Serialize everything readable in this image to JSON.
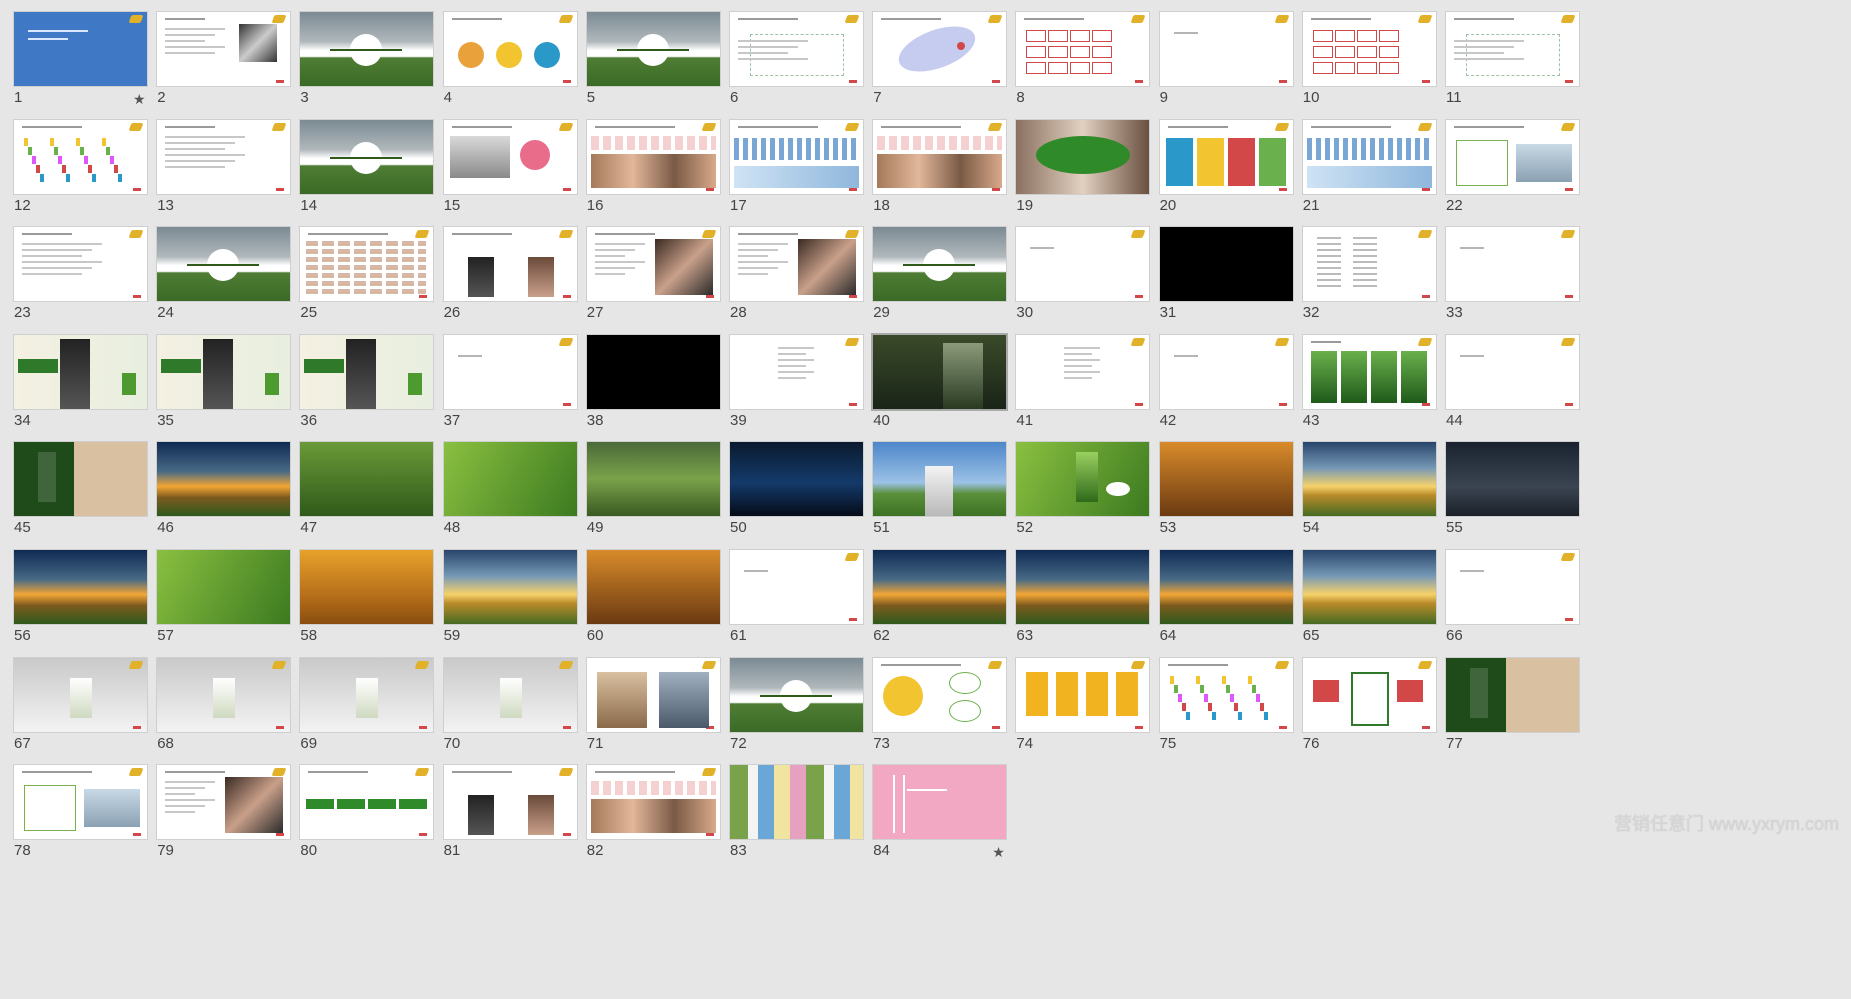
{
  "app": {
    "view": "slide-sorter"
  },
  "slides": [
    {
      "number": "1",
      "thumb": "blue",
      "selected": false,
      "star": true
    },
    {
      "number": "2",
      "thumb": "text-photo"
    },
    {
      "number": "3",
      "thumb": "field"
    },
    {
      "number": "4",
      "thumb": "circles"
    },
    {
      "number": "5",
      "thumb": "field"
    },
    {
      "number": "6",
      "thumb": "diagram"
    },
    {
      "number": "7",
      "thumb": "ellipse"
    },
    {
      "number": "8",
      "thumb": "table-red"
    },
    {
      "number": "9",
      "thumb": "blank-text"
    },
    {
      "number": "10",
      "thumb": "table-red"
    },
    {
      "number": "11",
      "thumb": "diagram"
    },
    {
      "number": "12",
      "thumb": "bars"
    },
    {
      "number": "13",
      "thumb": "text"
    },
    {
      "number": "14",
      "thumb": "field"
    },
    {
      "number": "15",
      "thumb": "photo-chart"
    },
    {
      "number": "16",
      "thumb": "photo-strip"
    },
    {
      "number": "17",
      "thumb": "chart-strip"
    },
    {
      "number": "18",
      "thumb": "photo-strip"
    },
    {
      "number": "19",
      "thumb": "photo-green"
    },
    {
      "number": "20",
      "thumb": "colorful"
    },
    {
      "number": "21",
      "thumb": "chart-strip"
    },
    {
      "number": "22",
      "thumb": "diagram-photo"
    },
    {
      "number": "23",
      "thumb": "text"
    },
    {
      "number": "24",
      "thumb": "field"
    },
    {
      "number": "25",
      "thumb": "table-list"
    },
    {
      "number": "26",
      "thumb": "people"
    },
    {
      "number": "27",
      "thumb": "photo-right"
    },
    {
      "number": "28",
      "thumb": "photo-right"
    },
    {
      "number": "29",
      "thumb": "field"
    },
    {
      "number": "30",
      "thumb": "blank-text"
    },
    {
      "number": "31",
      "thumb": "black"
    },
    {
      "number": "32",
      "thumb": "text-columns"
    },
    {
      "number": "33",
      "thumb": "blank-text"
    },
    {
      "number": "34",
      "thumb": "ad"
    },
    {
      "number": "35",
      "thumb": "ad"
    },
    {
      "number": "36",
      "thumb": "ad"
    },
    {
      "number": "37",
      "thumb": "blank-text"
    },
    {
      "number": "38",
      "thumb": "black"
    },
    {
      "number": "39",
      "thumb": "center-text"
    },
    {
      "number": "40",
      "thumb": "dark-photo",
      "selected": true
    },
    {
      "number": "41",
      "thumb": "center-text"
    },
    {
      "number": "42",
      "thumb": "blank-text"
    },
    {
      "number": "43",
      "thumb": "packs"
    },
    {
      "number": "44",
      "thumb": "blank-text"
    },
    {
      "number": "45",
      "thumb": "green-ad"
    },
    {
      "number": "46",
      "thumb": "sunset"
    },
    {
      "number": "47",
      "thumb": "green"
    },
    {
      "number": "48",
      "thumb": "green2"
    },
    {
      "number": "49",
      "thumb": "field2"
    },
    {
      "number": "50",
      "thumb": "night"
    },
    {
      "number": "51",
      "thumb": "sky"
    },
    {
      "number": "52",
      "thumb": "product-green"
    },
    {
      "number": "53",
      "thumb": "warm"
    },
    {
      "number": "54",
      "thumb": "sunset2"
    },
    {
      "number": "55",
      "thumb": "night2"
    },
    {
      "number": "56",
      "thumb": "sunset"
    },
    {
      "number": "57",
      "thumb": "green2"
    },
    {
      "number": "58",
      "thumb": "wheat"
    },
    {
      "number": "59",
      "thumb": "sunset2"
    },
    {
      "number": "60",
      "thumb": "warm"
    },
    {
      "number": "61",
      "thumb": "blank-text"
    },
    {
      "number": "62",
      "thumb": "sunset"
    },
    {
      "number": "63",
      "thumb": "sunset"
    },
    {
      "number": "64",
      "thumb": "sunset"
    },
    {
      "number": "65",
      "thumb": "sunset2"
    },
    {
      "number": "66",
      "thumb": "blank-text"
    },
    {
      "number": "67",
      "thumb": "room"
    },
    {
      "number": "68",
      "thumb": "room"
    },
    {
      "number": "69",
      "thumb": "room"
    },
    {
      "number": "70",
      "thumb": "room"
    },
    {
      "number": "71",
      "thumb": "phones"
    },
    {
      "number": "72",
      "thumb": "field"
    },
    {
      "number": "73",
      "thumb": "yellow-diagram"
    },
    {
      "number": "74",
      "thumb": "yellow-bars"
    },
    {
      "number": "75",
      "thumb": "bars"
    },
    {
      "number": "76",
      "thumb": "red-flow"
    },
    {
      "number": "77",
      "thumb": "green-ad"
    },
    {
      "number": "78",
      "thumb": "diagram-photo"
    },
    {
      "number": "79",
      "thumb": "photo-right"
    },
    {
      "number": "80",
      "thumb": "green-flow"
    },
    {
      "number": "81",
      "thumb": "people"
    },
    {
      "number": "82",
      "thumb": "photo-strip"
    },
    {
      "number": "83",
      "thumb": "table-color"
    },
    {
      "number": "84",
      "thumb": "pink",
      "star": true
    }
  ],
  "colors": {
    "background": "#e6e6e6",
    "accent_gold": "#e2b12a",
    "brand_red": "#d24848",
    "field_green": "#3a6a26",
    "title_blue": "#3f78c4",
    "pink": "#f2a7c3"
  },
  "star_glyph": "★",
  "watermark": "营销任意门 www.yxrym.com"
}
